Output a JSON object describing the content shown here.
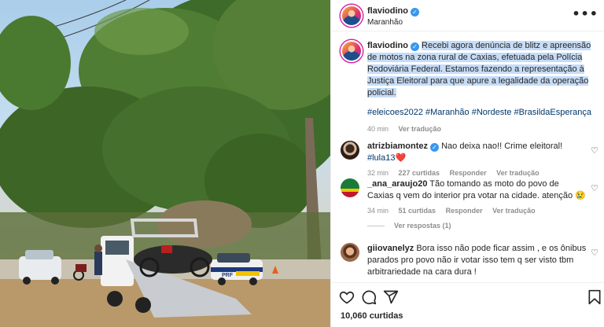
{
  "post": {
    "author": "flaviodino",
    "verified_mark": "✓",
    "location": "Maranhão",
    "more_icon": "•••",
    "caption": "Recebi agora denúncia de blitz e apreensão de motos na zona rural de Caxias, efetuada pela Polícia Rodoviária Federal. Estamos fazendo a representação à Justiça Eleitoral para que apure a legalidade da operação policial.",
    "hashtags": "#eleicoes2022 #Maranhão #Nordeste #BrasildaEsperança",
    "time": "40 min",
    "translate": "Ver tradução",
    "likes": "10,060 curtidas"
  },
  "comments": [
    {
      "user": "atrizbiamontez",
      "verified_mark": "✓",
      "text": "Nao deixa nao!! Crime eleitoral! ",
      "tag": "#lula13",
      "emoji": "❤️",
      "time": "32 min",
      "likes": "227 curtidas",
      "reply": "Responder",
      "translate": "Ver tradução"
    },
    {
      "user": "_ana_araujo20",
      "text": "Tão tomando as moto do povo de Caxias q vem do interior pra votar na cidade. atenção 😢",
      "time": "34 min",
      "likes": "51 curtidas",
      "reply": "Responder",
      "translate": "Ver tradução",
      "view_replies": "Ver respostas (1)"
    },
    {
      "user": "giiovanelyz",
      "text": "Bora isso não pode ficar assim , e os ônibus parados pro povo não ir votar isso tem q ser visto tbm arbitrariedade na cara dura !"
    }
  ],
  "icons": {
    "like": "heart-icon",
    "comment": "comment-icon",
    "share": "share-icon",
    "save": "bookmark-icon",
    "comment_like": "♡"
  },
  "photo": {
    "vehicle_label": "PRF"
  },
  "colors": {
    "link": "#00376b",
    "muted": "#8e8e8e",
    "verified": "#3897f0",
    "highlight": "#c6dcf7"
  }
}
